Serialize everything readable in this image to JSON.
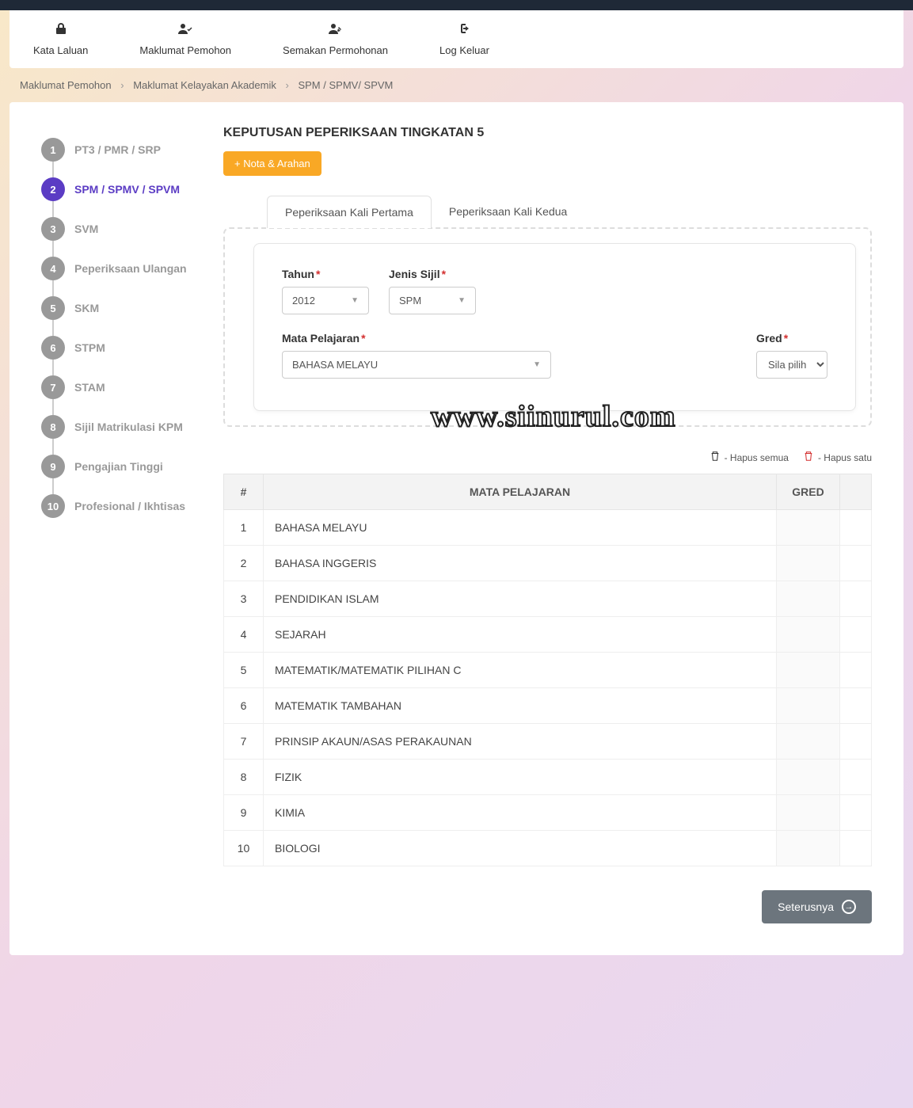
{
  "nav": {
    "items": [
      {
        "label": "Kata Laluan",
        "icon": "lock"
      },
      {
        "label": "Maklumat Pemohon",
        "icon": "user-check"
      },
      {
        "label": "Semakan Permohonan",
        "icon": "user-edit"
      },
      {
        "label": "Log Keluar",
        "icon": "logout"
      }
    ]
  },
  "breadcrumb": {
    "parts": [
      "Maklumat Pemohon",
      "Maklumat Kelayakan Akademik",
      "SPM / SPMV/ SPVM"
    ]
  },
  "stepper": {
    "items": [
      {
        "num": "1",
        "label": "PT3 / PMR / SRP"
      },
      {
        "num": "2",
        "label": "SPM / SPMV / SPVM"
      },
      {
        "num": "3",
        "label": "SVM"
      },
      {
        "num": "4",
        "label": "Peperiksaan Ulangan"
      },
      {
        "num": "5",
        "label": "SKM"
      },
      {
        "num": "6",
        "label": "STPM"
      },
      {
        "num": "7",
        "label": "STAM"
      },
      {
        "num": "8",
        "label": "Sijil Matrikulasi KPM"
      },
      {
        "num": "9",
        "label": "Pengajian Tinggi"
      },
      {
        "num": "10",
        "label": "Profesional / Ikhtisas"
      }
    ],
    "active_index": 1
  },
  "content": {
    "title": "KEPUTUSAN PEPERIKSAAN TINGKATAN 5",
    "nota_btn": "+ Nota & Arahan",
    "tabs": [
      {
        "label": "Peperiksaan Kali Pertama"
      },
      {
        "label": "Peperiksaan Kali Kedua"
      }
    ],
    "active_tab": 0,
    "form": {
      "tahun_label": "Tahun",
      "tahun_value": "2012",
      "jenis_label": "Jenis Sijil",
      "jenis_value": "SPM",
      "mata_label": "Mata Pelajaran",
      "mata_value": "BAHASA MELAYU",
      "gred_label": "Gred",
      "gred_value": "Sila pilih"
    },
    "legend": {
      "hapus_semua": "- Hapus semua",
      "hapus_satu": "- Hapus satu"
    },
    "table": {
      "headers": {
        "num": "#",
        "subject": "MATA PELAJARAN",
        "gred": "GRED"
      },
      "rows": [
        {
          "num": "1",
          "subject": "BAHASA MELAYU",
          "gred": ""
        },
        {
          "num": "2",
          "subject": "BAHASA INGGERIS",
          "gred": ""
        },
        {
          "num": "3",
          "subject": "PENDIDIKAN ISLAM",
          "gred": ""
        },
        {
          "num": "4",
          "subject": "SEJARAH",
          "gred": ""
        },
        {
          "num": "5",
          "subject": "MATEMATIK/MATEMATIK PILIHAN C",
          "gred": ""
        },
        {
          "num": "6",
          "subject": "MATEMATIK TAMBAHAN",
          "gred": ""
        },
        {
          "num": "7",
          "subject": "PRINSIP AKAUN/ASAS PERAKAUNAN",
          "gred": ""
        },
        {
          "num": "8",
          "subject": "FIZIK",
          "gred": ""
        },
        {
          "num": "9",
          "subject": "KIMIA",
          "gred": ""
        },
        {
          "num": "10",
          "subject": "BIOLOGI",
          "gred": ""
        }
      ]
    },
    "next_btn": "Seterusnya"
  },
  "watermark": "www.siinurul.com"
}
